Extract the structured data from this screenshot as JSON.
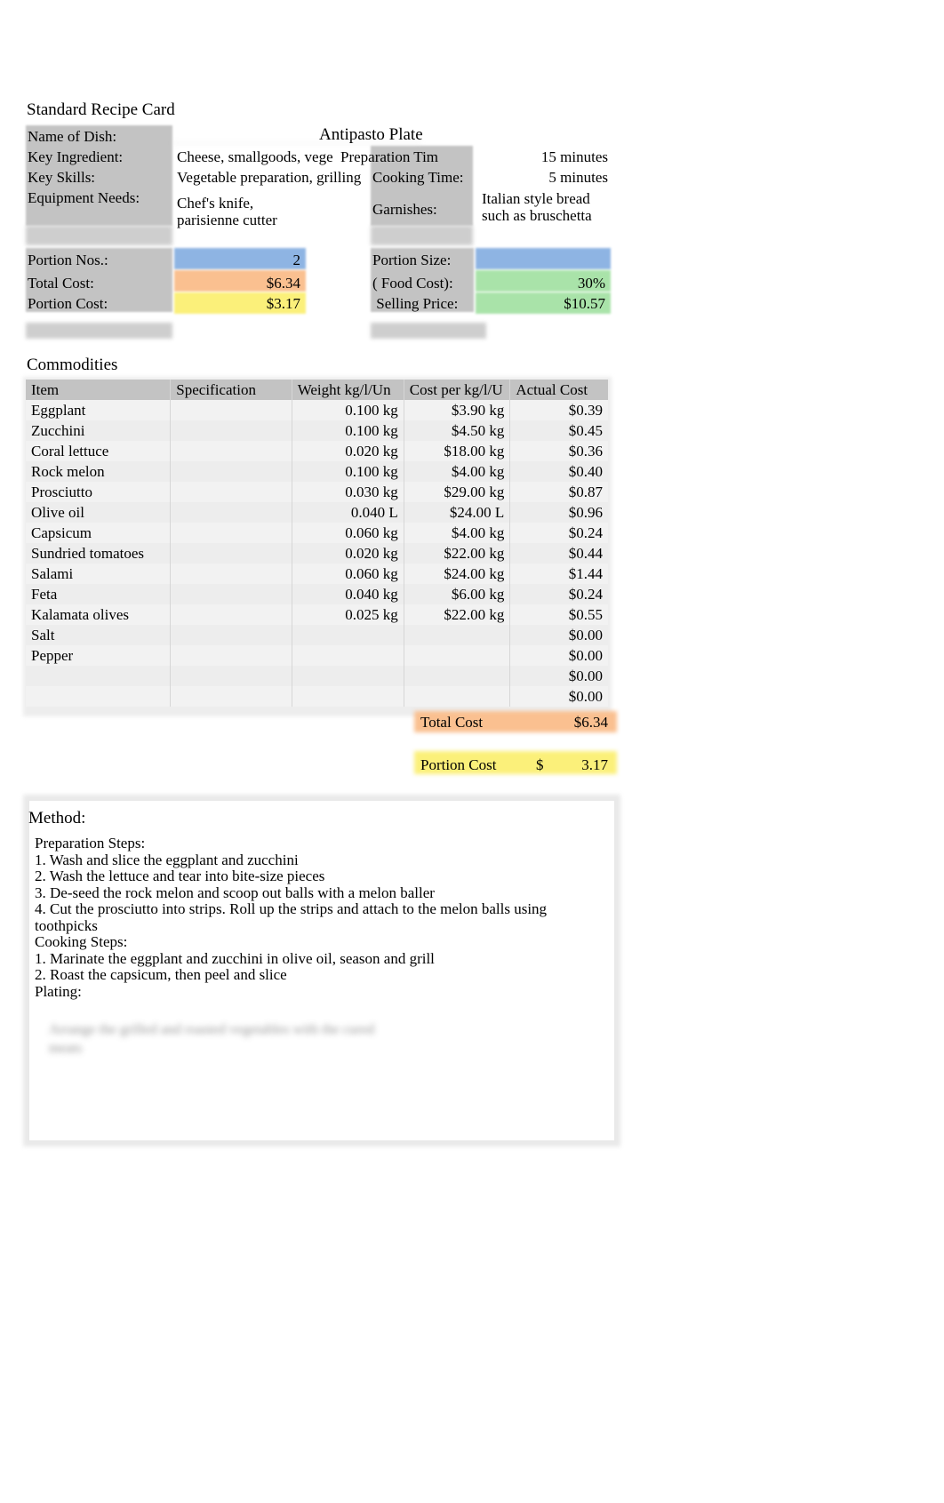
{
  "document": {
    "title": "Standard Recipe Card",
    "dish_name": "Antipasto Plate"
  },
  "details": {
    "labels": {
      "name_of_dish": "Name of Dish:",
      "key_ingredient": "Key Ingredient:",
      "key_skills": "Key Skills:",
      "equipment_needs": "Equipment Needs:",
      "preparation_time": "Preparation Tim",
      "cooking_time": "Cooking Time:",
      "garnishes": "Garnishes:"
    },
    "values": {
      "key_ingredient": "Cheese, smallgoods, vege",
      "key_skills": "Vegetable preparation, grilling",
      "equipment_needs": "Chef's knife,\nparisienne cutter",
      "preparation_time": "15 minutes",
      "cooking_time": "5 minutes",
      "garnishes": "Italian style bread\nsuch as bruschetta"
    }
  },
  "costing": {
    "labels": {
      "portion_nos": "Portion Nos.:",
      "total_cost": "Total Cost:",
      "portion_cost": "Portion Cost:",
      "portion_size": "Portion Size:",
      "food_cost": "( Food Cost):",
      "selling_price": " Selling Price:"
    },
    "values": {
      "portion_nos": "2",
      "total_cost": "$6.34",
      "portion_cost": "$3.17",
      "portion_size": "",
      "food_cost": "30%",
      "selling_price": "$10.57"
    },
    "colors": {
      "portion_nos": "#8eb4e3",
      "total_cost": "#fac090",
      "portion_cost": "#fbf07a",
      "portion_size": "#8eb4e3",
      "food_cost": "#a9e3a9",
      "selling_price": "#a9e3a9"
    }
  },
  "commodities": {
    "section_title": "Commodities",
    "columns": [
      "Item",
      "Specification",
      "Weight kg/l/Un",
      "Cost per kg/l/U",
      "Actual Cost"
    ],
    "rows": [
      {
        "item": "Eggplant",
        "spec": "",
        "weight": "0.100 kg",
        "cost": "$3.90 kg",
        "actual": "$0.39"
      },
      {
        "item": "Zucchini",
        "spec": "",
        "weight": "0.100 kg",
        "cost": "$4.50 kg",
        "actual": "$0.45"
      },
      {
        "item": "Coral lettuce",
        "spec": "",
        "weight": "0.020 kg",
        "cost": "$18.00 kg",
        "actual": "$0.36"
      },
      {
        "item": "Rock melon",
        "spec": "",
        "weight": "0.100 kg",
        "cost": "$4.00 kg",
        "actual": "$0.40"
      },
      {
        "item": "Prosciutto",
        "spec": "",
        "weight": "0.030 kg",
        "cost": "$29.00 kg",
        "actual": "$0.87"
      },
      {
        "item": "Olive oil",
        "spec": "",
        "weight": "0.040 L",
        "cost": "$24.00 L",
        "actual": "$0.96"
      },
      {
        "item": "Capsicum",
        "spec": "",
        "weight": "0.060 kg",
        "cost": "$4.00 kg",
        "actual": "$0.24"
      },
      {
        "item": "Sundried tomatoes",
        "spec": "",
        "weight": "0.020 kg",
        "cost": "$22.00 kg",
        "actual": "$0.44"
      },
      {
        "item": "Salami",
        "spec": "",
        "weight": "0.060 kg",
        "cost": "$24.00 kg",
        "actual": "$1.44"
      },
      {
        "item": "Feta",
        "spec": "",
        "weight": "0.040 kg",
        "cost": "$6.00 kg",
        "actual": "$0.24"
      },
      {
        "item": "Kalamata olives",
        "spec": "",
        "weight": "0.025 kg",
        "cost": "$22.00 kg",
        "actual": "$0.55"
      },
      {
        "item": "Salt",
        "spec": "",
        "weight": "",
        "cost": "",
        "actual": "$0.00"
      },
      {
        "item": "Pepper",
        "spec": "",
        "weight": "",
        "cost": "",
        "actual": "$0.00"
      },
      {
        "item": "",
        "spec": "",
        "weight": "",
        "cost": "",
        "actual": "$0.00"
      },
      {
        "item": "",
        "spec": "",
        "weight": "",
        "cost": "",
        "actual": "$0.00"
      }
    ],
    "totals": {
      "total_cost_label": "Total Cost",
      "total_cost_value": "$6.34",
      "portion_cost_label": "Portion Cost",
      "portion_cost_currency": "$",
      "portion_cost_value": "3.17"
    }
  },
  "method": {
    "title": "Method:",
    "body": "Preparation Steps:\n1. Wash and slice the eggplant and zucchini\n2. Wash the lettuce and tear into bite-size pieces\n3. De-seed the rock melon and scoop out balls with a melon baller\n4. Cut the prosciutto into strips. Roll up the strips and attach to the melon balls using\ntoothpicks\nCooking Steps:\n1. Marinate the eggplant and zucchini in olive oil, season and grill\n2. Roast the capsicum, then peel and slice\nPlating:",
    "redacted_note": "Arrange the grilled and roasted vegetables with the cured\nmeats"
  }
}
